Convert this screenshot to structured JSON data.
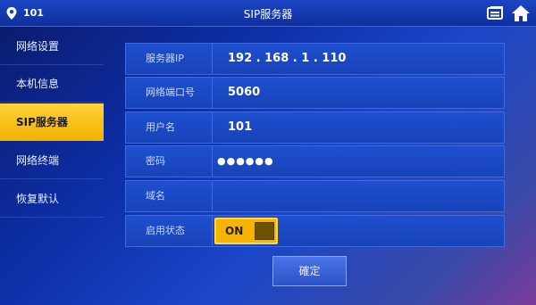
{
  "header": {
    "room_number": "101",
    "title": "SIP服务器",
    "icons": [
      "location-pin-icon",
      "card-icon",
      "home-icon"
    ]
  },
  "sidebar": {
    "items": [
      {
        "label": "网络设置",
        "active": false
      },
      {
        "label": "本机信息",
        "active": false
      },
      {
        "label": "SIP服务器",
        "active": true
      },
      {
        "label": "网络终端",
        "active": false
      },
      {
        "label": "恢复默认",
        "active": false
      }
    ]
  },
  "form": {
    "server_ip": {
      "label": "服务器IP",
      "value": "192 . 168 . 1 . 110"
    },
    "port": {
      "label": "网络端口号",
      "value": "5060"
    },
    "username": {
      "label": "用户名",
      "value": "101"
    },
    "password": {
      "label": "密码",
      "value": "●●●●●●"
    },
    "domain": {
      "label": "域名",
      "value": ""
    },
    "status": {
      "label": "启用状态",
      "value": "ON"
    }
  },
  "actions": {
    "confirm_label": "確定"
  },
  "colors": {
    "accent": "#f4b400",
    "panel": "#1e4fd0",
    "topbar": "#1b45c4"
  }
}
